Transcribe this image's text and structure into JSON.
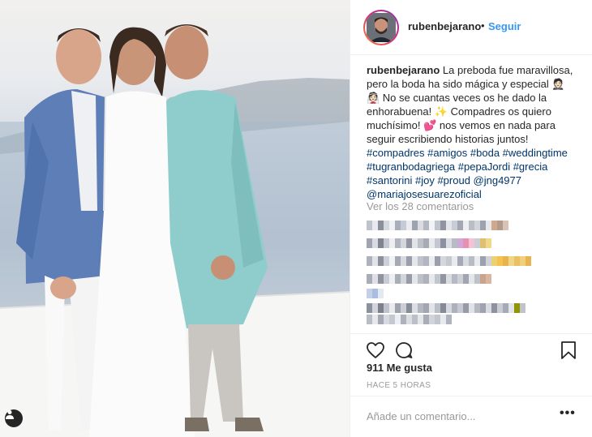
{
  "post": {
    "username": "rubenbejarano",
    "separator": "•",
    "follow_label": "Seguir",
    "caption_text": " La preboda fue maravillosa, pero la boda ha sido mágica y especial 🤵🏻 👰🏻 No se cuantas veces os he dado la enhorabuena! ✨ Compadres os quiero muchísimo! 💕 nos vemos en nada para seguir escribiendo historias juntos! ",
    "hashtags": "#compadres #amigos #boda #weddingtime #tugranbodagriega #pepaJordi #grecia #santorini #joy #proud @jng4977 @mariajosesuarezoficial",
    "view_comments": "Ver los 28 comentarios",
    "likes": "911 Me gusta",
    "time": "HACE 5 HORAS",
    "comment_placeholder": "Añade un comentario...",
    "more_label": "•••"
  },
  "icons": {
    "like": "heart-icon",
    "comment": "comment-bubble-icon",
    "save": "bookmark-icon",
    "tagged": "user-tag-icon"
  },
  "colors": {
    "link": "#3897f0",
    "hashtag": "#003569",
    "muted": "#999999",
    "border": "#efefef"
  }
}
